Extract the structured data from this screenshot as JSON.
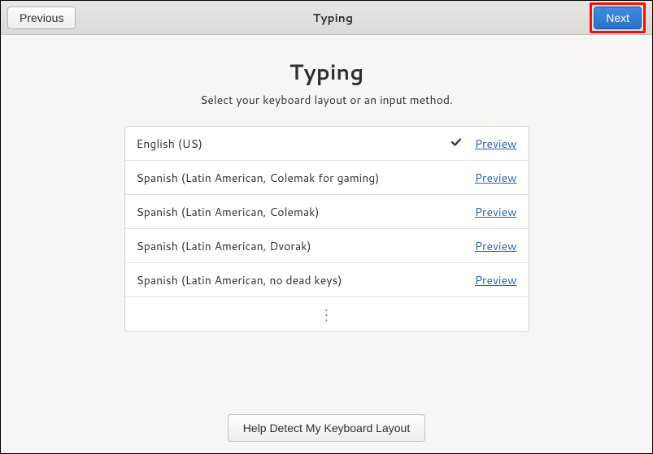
{
  "header": {
    "previous_label": "Previous",
    "title": "Typing",
    "next_label": "Next"
  },
  "page": {
    "title": "Typing",
    "subtitle": "Select your keyboard layout or an input method."
  },
  "layouts": [
    {
      "label": "English (US)",
      "selected": true,
      "preview": "Preview"
    },
    {
      "label": "Spanish (Latin American, Colemak for gaming)",
      "selected": false,
      "preview": "Preview"
    },
    {
      "label": "Spanish (Latin American, Colemak)",
      "selected": false,
      "preview": "Preview"
    },
    {
      "label": "Spanish (Latin American, Dvorak)",
      "selected": false,
      "preview": "Preview"
    },
    {
      "label": "Spanish (Latin American, no dead keys)",
      "selected": false,
      "preview": "Preview"
    }
  ],
  "detect_button": "Help Detect My Keyboard Layout"
}
